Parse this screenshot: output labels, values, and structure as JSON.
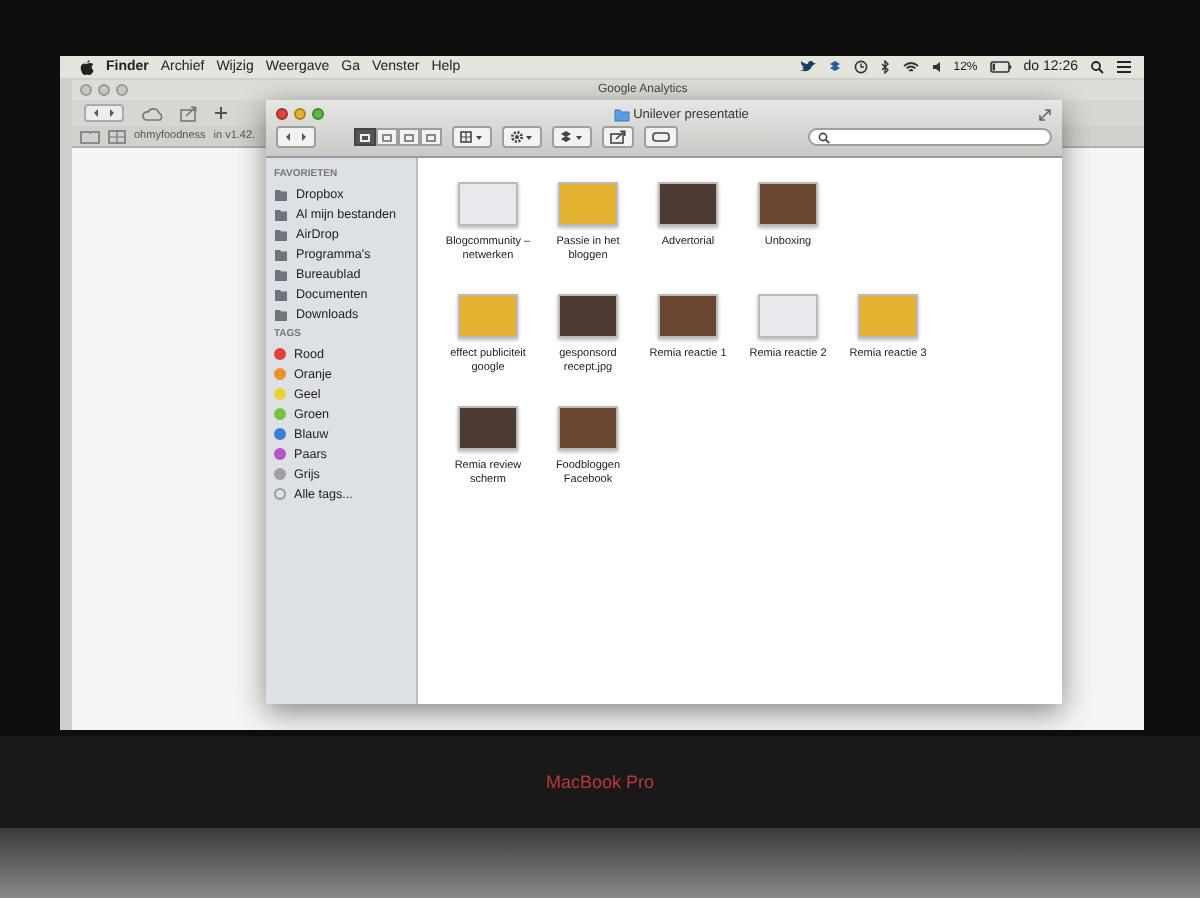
{
  "menu_bar": {
    "app": "Finder",
    "menus": [
      "Archief",
      "Wijzig",
      "Weergave",
      "Ga",
      "Venster",
      "Help"
    ],
    "battery": "12%",
    "clock": "do 12:26"
  },
  "browser_window": {
    "title": "Google Analytics",
    "bookmarks": [
      "ohmyfoodness",
      "in v1.42."
    ]
  },
  "finder": {
    "title": "Unilever presentatie",
    "view_modes": [
      {
        "selected": true
      },
      {
        "selected": false
      },
      {
        "selected": false
      },
      {
        "selected": false
      }
    ],
    "sidebar": [
      {
        "heading": "FAVORIETEN",
        "items": [
          {
            "kind": "place",
            "label": "Dropbox"
          },
          {
            "kind": "place",
            "label": "Al mijn bestanden"
          },
          {
            "kind": "place",
            "label": "AirDrop"
          },
          {
            "kind": "place",
            "label": "Programma's"
          },
          {
            "kind": "place",
            "label": "Bureaublad"
          },
          {
            "kind": "place",
            "label": "Documenten"
          },
          {
            "kind": "place",
            "label": "Downloads"
          }
        ]
      },
      {
        "heading": "TAGS",
        "items": [
          {
            "kind": "tag",
            "label": "Rood",
            "color": "#e5413b"
          },
          {
            "kind": "tag",
            "label": "Oranje",
            "color": "#f0902c"
          },
          {
            "kind": "tag",
            "label": "Geel",
            "color": "#e8d23a"
          },
          {
            "kind": "tag",
            "label": "Groen",
            "color": "#7cc142"
          },
          {
            "kind": "tag",
            "label": "Blauw",
            "color": "#3a7fd5"
          },
          {
            "kind": "tag",
            "label": "Paars",
            "color": "#b455c9"
          },
          {
            "kind": "tag",
            "label": "Grijs",
            "color": "#a0a0a0"
          },
          {
            "kind": "all",
            "label": "Alle tags..."
          }
        ]
      }
    ],
    "file_rows": [
      [
        {
          "name": "Blogcommunity – netwerken"
        },
        {
          "name": "Passie in het bloggen"
        },
        {
          "name": "Advertorial"
        },
        {
          "name": "Unboxing"
        }
      ],
      [
        {
          "name": "effect publiciteit google"
        },
        {
          "name": "gesponsord recept.jpg"
        },
        {
          "name": "Remia reactie 1"
        },
        {
          "name": "Remia reactie 2"
        },
        {
          "name": "Remia reactie 3"
        }
      ],
      [
        {
          "name": "Remia review scherm"
        },
        {
          "name": "Foodbloggen Facebook"
        }
      ]
    ]
  },
  "laptop": {
    "model": "MacBook Pro"
  }
}
